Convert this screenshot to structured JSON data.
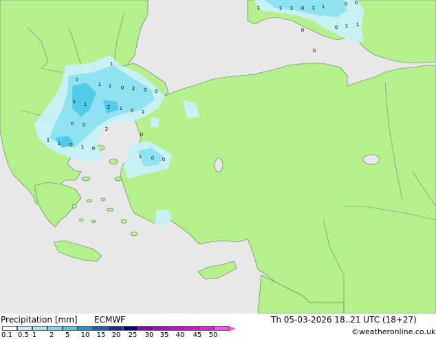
{
  "map": {
    "colors": {
      "sea": "#e8e8e8",
      "land": "#b4f08c",
      "border": "#777777",
      "coast": "#5a6f5a",
      "precip_light": "#c8f0f8",
      "precip_mid": "#8ce0f0",
      "precip_heavy": "#50c8e6"
    },
    "cell_values": [
      "1",
      "1",
      "1",
      "0",
      "1",
      "1",
      "0",
      "0",
      "0",
      "1",
      "1",
      "0",
      "0",
      "1",
      "0",
      "1",
      "1",
      "0",
      "2",
      "0",
      "0",
      "1",
      "1",
      "2",
      "1",
      "0",
      "1",
      "0",
      "0",
      "2",
      "1",
      "1",
      "0",
      "1",
      "0",
      "0",
      "1",
      "0",
      "0"
    ]
  },
  "legend": {
    "title": "Precipitation [mm]",
    "model": "ECMWF",
    "datetime": "Th 05-03-2026 18..21 UTC (18+27)",
    "credit": "©weatheronline.co.uk",
    "ticks": [
      "0.1",
      "0.5",
      "1",
      "2",
      "5",
      "10",
      "15",
      "20",
      "25",
      "30",
      "35",
      "40",
      "45",
      "50"
    ],
    "swatch_colors": [
      "#f0fcff",
      "#c8f0f8",
      "#a0e6f4",
      "#78dcf0",
      "#50c8e6",
      "#1e96d2",
      "#1464be",
      "#0a32a0",
      "#000080",
      "#8c00c8",
      "#b400dc",
      "#d200e6",
      "#e600e6",
      "#f014f0",
      "#ff50ff"
    ]
  }
}
